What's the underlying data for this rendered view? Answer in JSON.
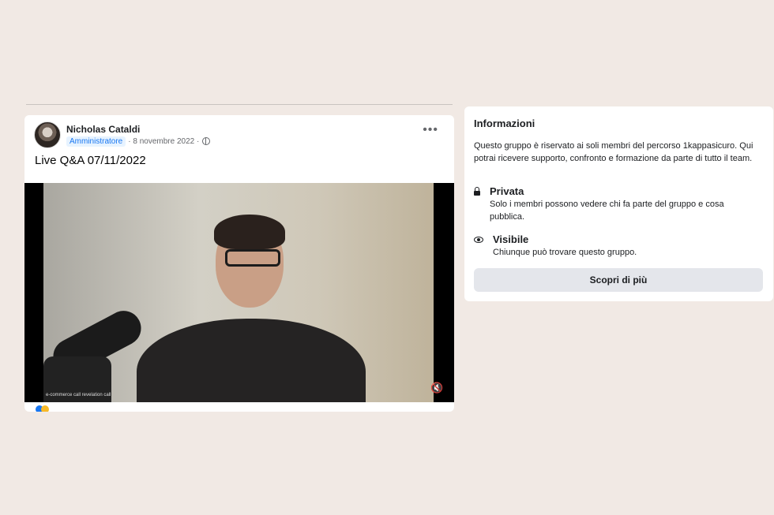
{
  "post": {
    "author": "Nicholas Cataldi",
    "role_badge": "Amministratore",
    "meta": "· 8 novembre 2022 ·",
    "title": "Live Q&A 07/11/2022",
    "video_caption": "e-commerce call revelation call",
    "icons": {
      "more": "more-options-icon",
      "visibility": "globe-icon",
      "mute": "muted-speaker-icon"
    }
  },
  "info": {
    "title": "Informazioni",
    "description": "Questo gruppo è riservato ai soli membri del percorso 1kappasicuro. Qui potrai ricevere supporto, confronto e formazione da parte di tutto il team.",
    "private_label": "Privata",
    "private_text": "Solo i membri possono vedere chi fa parte del gruppo e cosa pubblica.",
    "visible_label": "Visibile",
    "visible_text": "Chiunque può trovare questo gruppo.",
    "button": "Scopri di più"
  },
  "colors": {
    "background": "#f1e9e4",
    "card": "#ffffff",
    "badge_bg": "#e7f3ff",
    "badge_text": "#1877f2",
    "button_bg": "#e4e6eb"
  }
}
